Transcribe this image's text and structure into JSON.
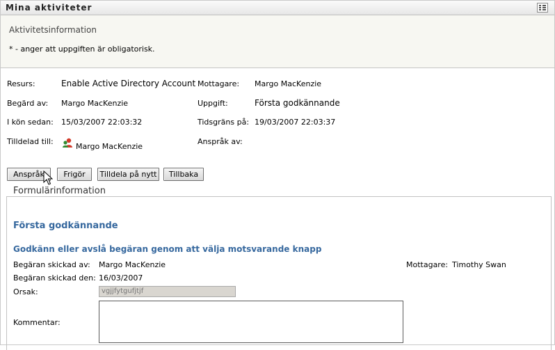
{
  "window": {
    "title": "Mina aktiviteter",
    "menu_icon": "list-icon"
  },
  "header": {
    "subtitle": "Aktivitetsinformation",
    "required_note": "* - anger att uppgiften är obligatorisk."
  },
  "details": {
    "resurs_label": "Resurs:",
    "resurs_value": "Enable Active Directory Account",
    "mottagare_label": "Mottagare:",
    "mottagare_value": "Margo MacKenzie",
    "begard_label": "Begärd av:",
    "begard_value": "Margo MacKenzie",
    "uppgift_label": "Uppgift:",
    "uppgift_value": "Första godkännande",
    "ikon_label": "I kön sedan:",
    "ikon_value": "15/03/2007 22:03:32",
    "tidsgrans_label": "Tidsgräns på:",
    "tidsgrans_value": "19/03/2007 22:03:37",
    "tilldelad_label": "Tilldelad till:",
    "tilldelad_value": "Margo MacKenzie",
    "anspraksav_label": "Anspråk av:"
  },
  "buttons": {
    "claim": "Anspråk",
    "release": "Frigör",
    "reassign": "Tilldela på nytt",
    "back": "Tillbaka"
  },
  "form": {
    "legend": "Formulärinformation",
    "title": "Första godkännande",
    "instruction": "Godkänn eller avslå begäran genom att välja motsvarande knapp",
    "sent_by_label": "Begäran skickad av:",
    "sent_by_value": "Margo MacKenzie",
    "recipient_label": "Mottagare:",
    "recipient_value": "Timothy Swan",
    "sent_date_label": "Begäran skickad den:",
    "sent_date_value": "16/03/2007",
    "reason_label": "Orsak:",
    "reason_value": "vgjjfytgufjtjf",
    "comment_label": "Kommentar:"
  }
}
